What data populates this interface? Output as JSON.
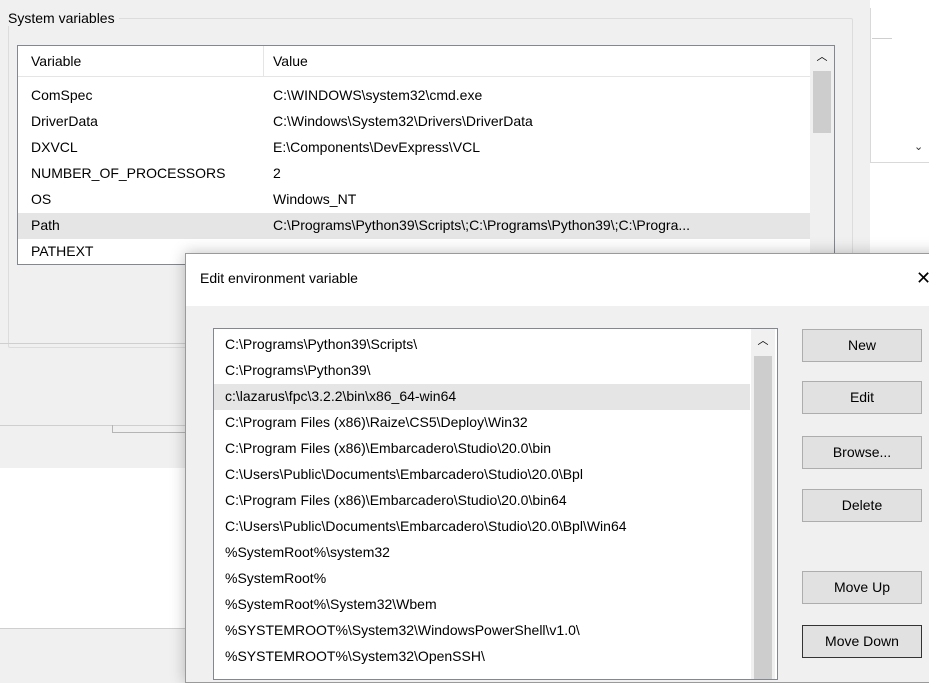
{
  "background": {
    "group_label": "System variables",
    "columns": {
      "variable": "Variable",
      "value": "Value"
    },
    "rows": [
      {
        "variable": "ComSpec",
        "value": "C:\\WINDOWS\\system32\\cmd.exe"
      },
      {
        "variable": "DriverData",
        "value": "C:\\Windows\\System32\\Drivers\\DriverData"
      },
      {
        "variable": "DXVCL",
        "value": "E:\\Components\\DevExpress\\VCL"
      },
      {
        "variable": "NUMBER_OF_PROCESSORS",
        "value": "2"
      },
      {
        "variable": "OS",
        "value": "Windows_NT"
      },
      {
        "variable": "Path",
        "value": "C:\\Programs\\Python39\\Scripts\\;C:\\Programs\\Python39\\;C:\\Progra..."
      },
      {
        "variable": "PATHEXT",
        "value": ""
      }
    ],
    "selected_row": "Path"
  },
  "dialog": {
    "title": "Edit environment variable",
    "close_icon": "close-icon",
    "paths": [
      "C:\\Programs\\Python39\\Scripts\\",
      "C:\\Programs\\Python39\\",
      "c:\\lazarus\\fpc\\3.2.2\\bin\\x86_64-win64",
      "C:\\Program Files (x86)\\Raize\\CS5\\Deploy\\Win32",
      "C:\\Program Files (x86)\\Embarcadero\\Studio\\20.0\\bin",
      "C:\\Users\\Public\\Documents\\Embarcadero\\Studio\\20.0\\Bpl",
      "C:\\Program Files (x86)\\Embarcadero\\Studio\\20.0\\bin64",
      "C:\\Users\\Public\\Documents\\Embarcadero\\Studio\\20.0\\Bpl\\Win64",
      "%SystemRoot%\\system32",
      "%SystemRoot%",
      "%SystemRoot%\\System32\\Wbem",
      "%SYSTEMROOT%\\System32\\WindowsPowerShell\\v1.0\\",
      "%SYSTEMROOT%\\System32\\OpenSSH\\"
    ],
    "selected_path": "c:\\lazarus\\fpc\\3.2.2\\bin\\x86_64-win64",
    "buttons": {
      "new": "New",
      "edit": "Edit",
      "browse": "Browse...",
      "delete": "Delete",
      "move_up": "Move Up",
      "move_down": "Move Down"
    },
    "focused_button": "move_down"
  },
  "icons": {
    "scroll_up": "chevron-up-icon",
    "dropdown": "chevron-down-icon"
  },
  "colors": {
    "window_bg": "#f0f0f0",
    "list_bg": "#ffffff",
    "selection": "#e5e5e5",
    "button_bg": "#e1e1e1",
    "button_border": "#adadad"
  }
}
